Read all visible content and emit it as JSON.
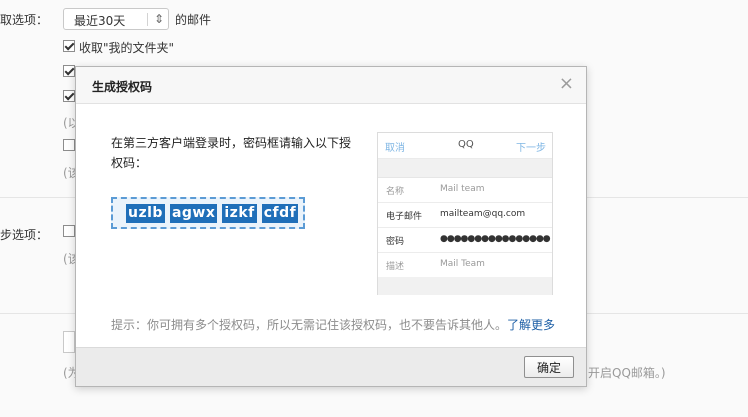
{
  "background": {
    "receive_option_label": "取选项：",
    "period_select_value": "最近30天",
    "period_suffix": "的邮件",
    "my_folder_checkbox_label": "收取\"我的文件夹\"",
    "paren_1": "(以",
    "paren_2": "(该",
    "sync_option_label": "步选项：",
    "paren_3": "(该",
    "paren_4": "(为",
    "footer_tail": "开启QQ邮箱。)"
  },
  "dialog": {
    "title": "生成授权码",
    "close_glyph": "×",
    "instruction": "在第三方客户端登录时，密码框请输入以下授权码：",
    "auth_code_segments": [
      "uzlb",
      "agwx",
      "izkf",
      "cfdf"
    ],
    "phone_preview": {
      "nav_left": "取消",
      "nav_center": "QQ",
      "nav_right": "下一步",
      "rows": [
        {
          "label": "名称",
          "value": "Mail team"
        },
        {
          "label": "电子邮件",
          "value": "mailteam@qq.com"
        },
        {
          "label": "密码",
          "value": "●●●●●●●●●●●●●●●●"
        },
        {
          "label": "描述",
          "value": "Mail Team"
        }
      ]
    },
    "tip": "提示：你可拥有多个授权码，所以无需记住该授权码，也不要告诉其他人。",
    "learn_more": "了解更多",
    "ok_label": "确定"
  },
  "colors": {
    "code_highlight": "#1f6fb9",
    "link": "#1d5fa6",
    "phone_nav_link": "#7fb6e4"
  }
}
